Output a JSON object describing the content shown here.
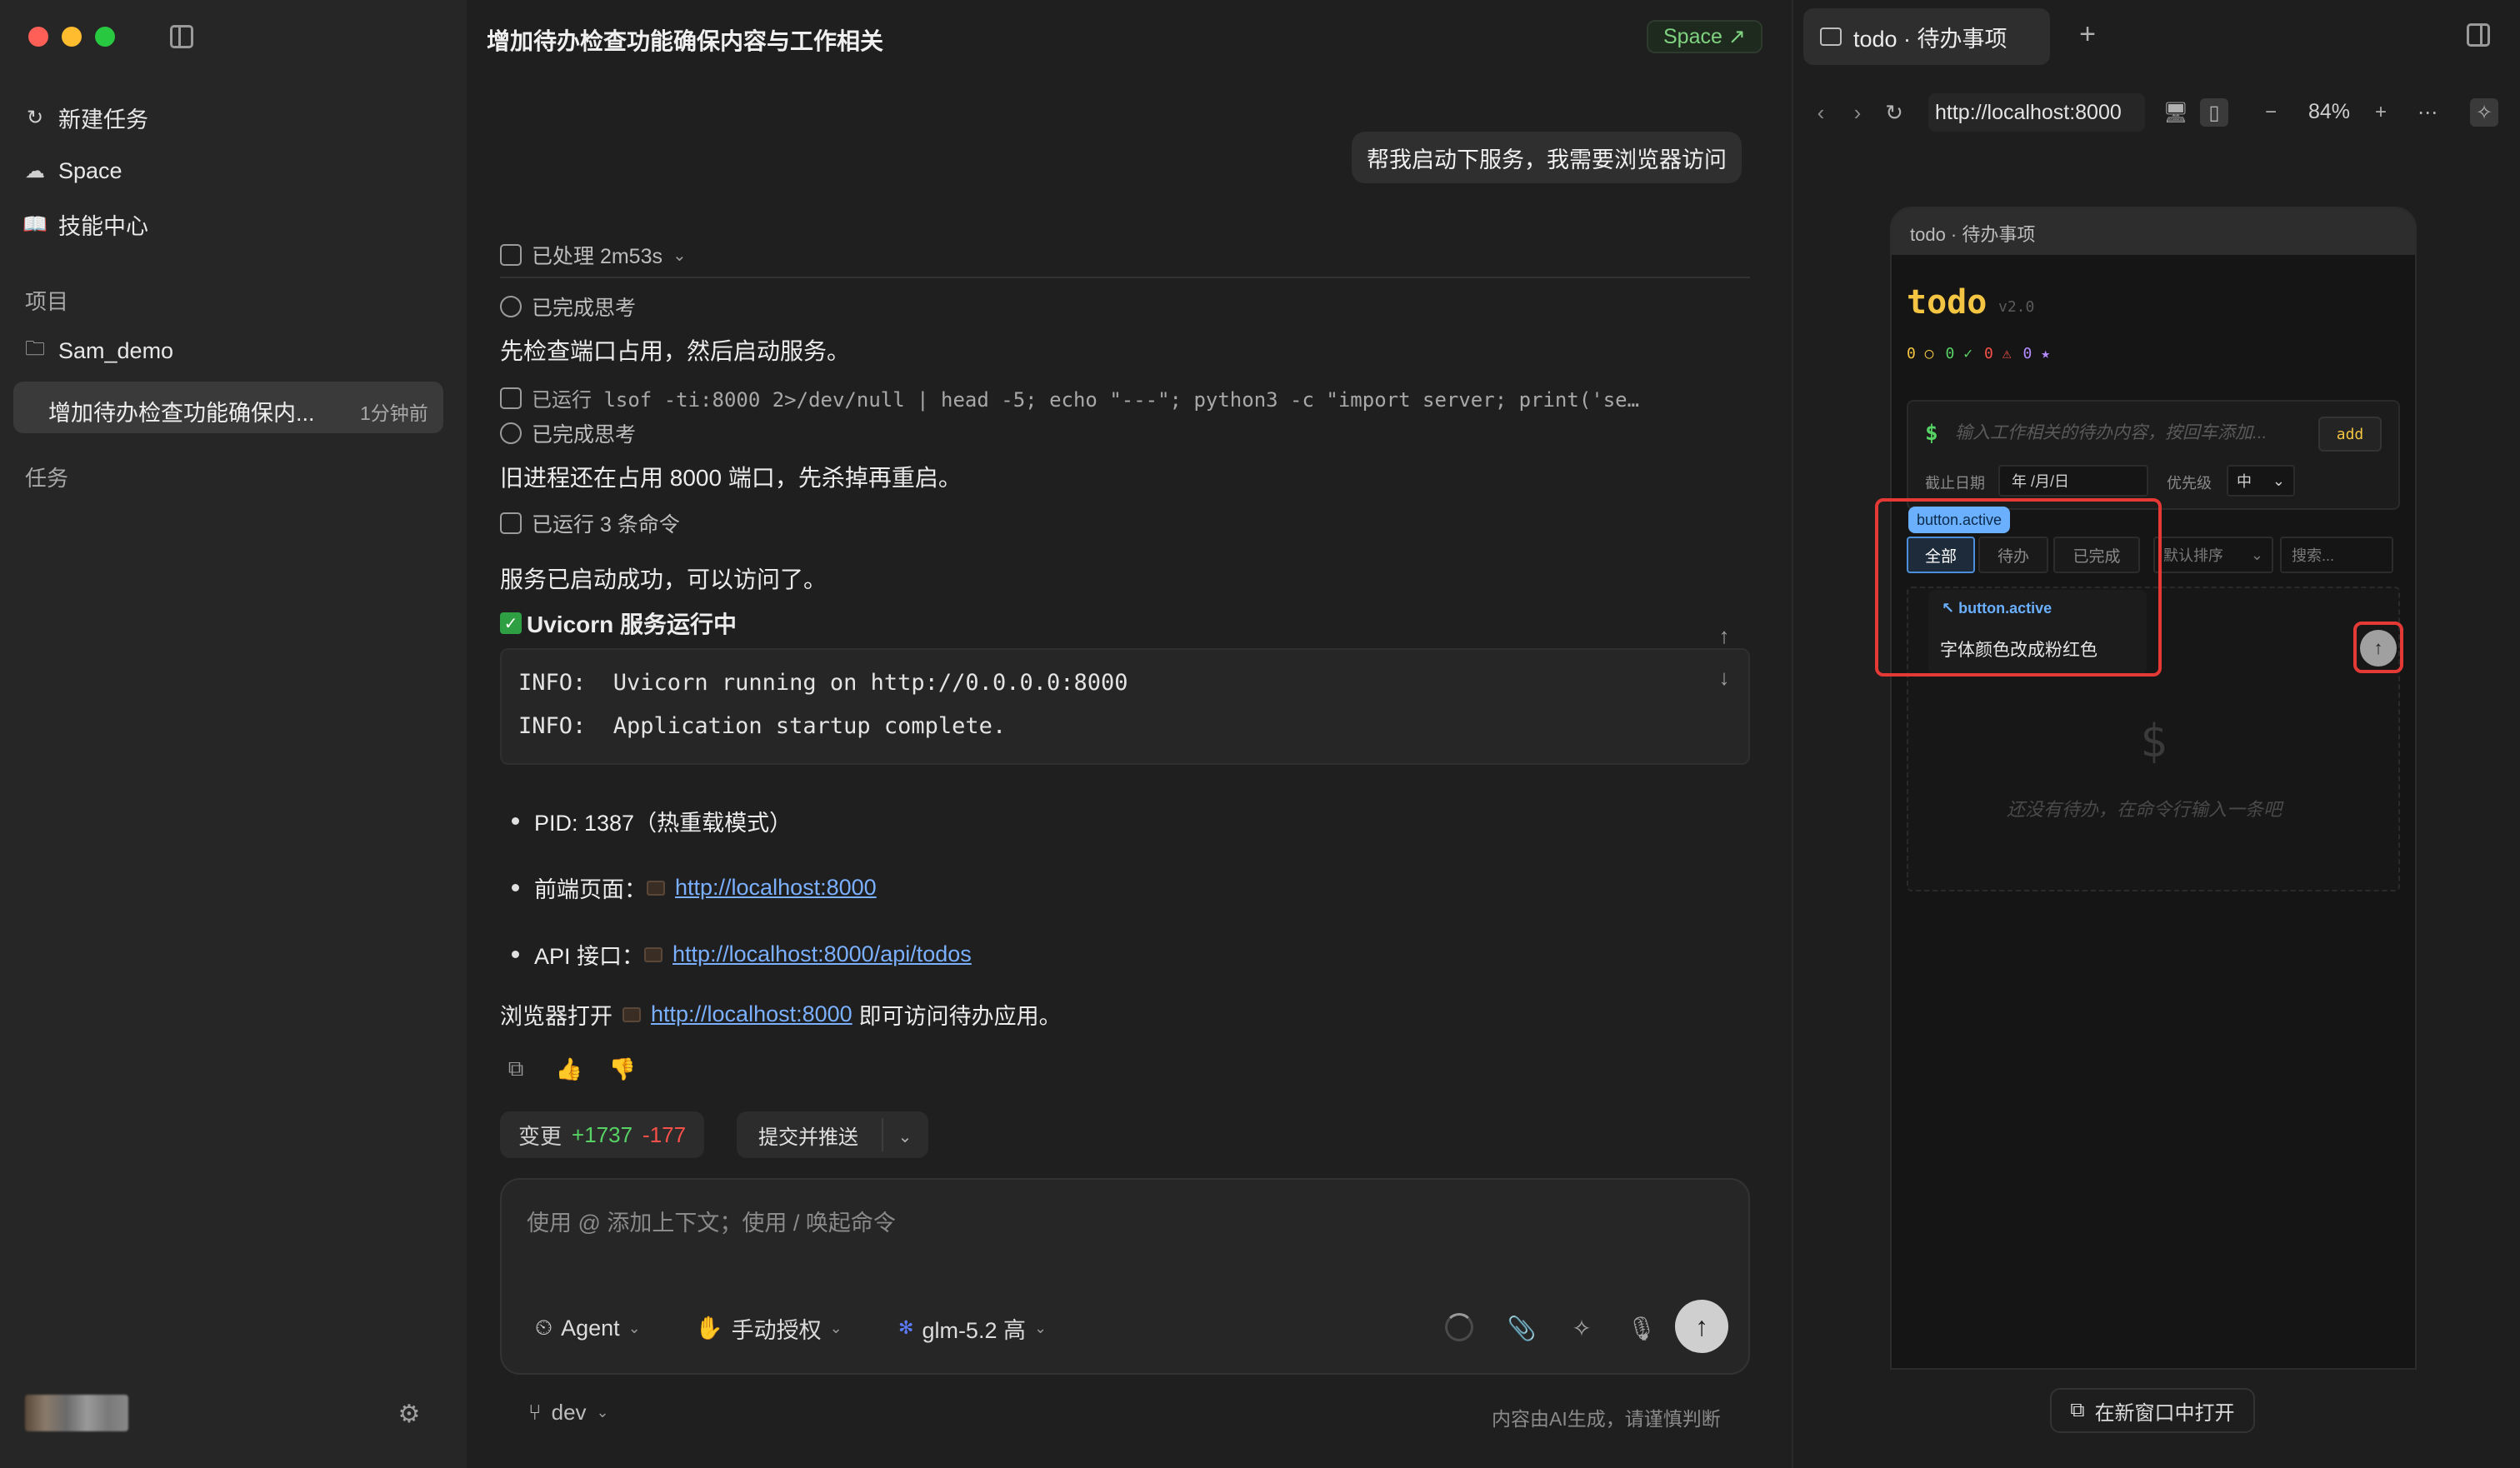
{
  "sidebar": {
    "nav": [
      {
        "label": "新建任务",
        "icon": "new-task-icon"
      },
      {
        "label": "Space",
        "icon": "cloud-icon"
      },
      {
        "label": "技能中心",
        "icon": "book-icon"
      }
    ],
    "projects_label": "项目",
    "project_name": "Sam_demo",
    "active_task": {
      "title": "增加待办检查功能确保内...",
      "time": "1分钟前"
    },
    "tasks_label": "任务"
  },
  "chat": {
    "title": "增加待办检查功能确保内容与工作相关",
    "space_badge": "Space ↗",
    "user_message": "帮我启动下服务，我需要浏览器访问",
    "processed": "已处理 2m53s",
    "thought1": "已完成思考",
    "text1": "先检查端口占用，然后启动服务。",
    "ran_cmd": "已运行 lsof -ti:8000 2>/dev/null | head -5; echo \"---\"; python3 -c \"import server; print('se…",
    "thought2": "已完成思考",
    "text2": "旧进程还在占用 8000 端口，先杀掉再重启。",
    "ran3": "已运行 3 条命令",
    "text3": "服务已启动成功，可以访问了。",
    "uvicorn_heading": "Uvicorn 服务运行中",
    "code_lines": [
      "INFO:  Uvicorn running on http://0.0.0.0:8000",
      "INFO:  Application startup complete."
    ],
    "pid": "PID: 1387（热重载模式）",
    "frontend_label": "前端页面：",
    "frontend_link": "http://localhost:8000",
    "api_label": "API 接口：",
    "api_link": "http://localhost:8000/api/todos",
    "browser_prefix": "浏览器打开",
    "browser_link": "http://localhost:8000",
    "browser_suffix": "即可访问待办应用。",
    "changes_label": "变更",
    "added": "+1737",
    "removed": "-177",
    "commit_label": "提交并推送",
    "composer_placeholder": "使用 @ 添加上下文；使用 / 唤起命令",
    "agent_label": "Agent",
    "auth_label": "手动授权",
    "model_label": "glm-5.2 高",
    "branch": "dev",
    "disclaimer": "内容由AI生成，请谨慎判断"
  },
  "browser": {
    "tab_title": "todo · 待办事项",
    "url": "http://localhost:8000",
    "zoom": "84%",
    "open_in_window": "在新窗口中打开",
    "app": {
      "window_title": "todo · 待办事项",
      "title": "todo",
      "version": "v2.0",
      "stats": [
        {
          "text": "0 ○",
          "color": "#f4c542"
        },
        {
          "text": "0 ✓",
          "color": "#56d364"
        },
        {
          "text": "0 ⚠",
          "color": "#f85149"
        },
        {
          "text": "0 ★",
          "color": "#b58cff"
        }
      ],
      "input_placeholder": "输入工作相关的待办内容，按回车添加...",
      "add_label": "add",
      "deadline_label": "截止日期",
      "date_value": "年 /月/日",
      "priority_label": "优先级",
      "priority_value": "中",
      "active_tag": "button.active",
      "filters": [
        "全部",
        "待办",
        "已完成"
      ],
      "sort_label": "默认排序",
      "search_placeholder": "搜索...",
      "popover_selector": "button.active",
      "popover_note": "字体颜色改成粉红色",
      "empty_dollar": "$",
      "empty_text": "还没有待办，在命令行输入一条吧"
    }
  },
  "colors": {
    "accent_green": "#56d364",
    "accent_red": "#f85149",
    "link_blue": "#7ab0ff",
    "todo_yellow": "#f4c542",
    "highlight_red": "#e53935"
  }
}
